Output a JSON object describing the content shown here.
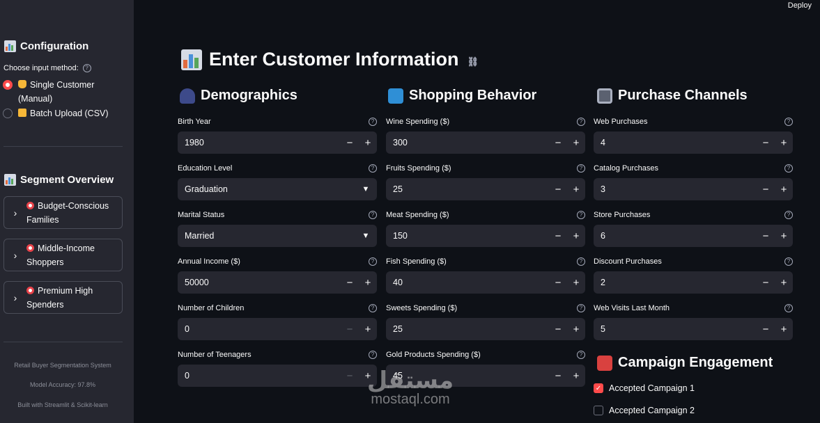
{
  "app": {
    "deploy_label": "Deploy"
  },
  "sidebar": {
    "config_title": "Configuration",
    "input_method_label": "Choose input method:",
    "options": [
      {
        "label_line1": "Single Customer",
        "label_line2": "(Manual)",
        "selected": true
      },
      {
        "label_line1": "Batch Upload (CSV)",
        "selected": false
      }
    ],
    "segment_title": "Segment Overview",
    "segments": [
      {
        "line1": "Budget-Conscious",
        "line2": "Families"
      },
      {
        "line1": "Middle-Income",
        "line2": "Shoppers"
      },
      {
        "line1": "Premium High",
        "line2": "Spenders"
      }
    ],
    "footer": {
      "system": "Retail Buyer Segmentation System",
      "accuracy": "Model Accuracy: 97.8%",
      "built": "Built with Streamlit & Scikit-learn"
    }
  },
  "main": {
    "title": "Enter Customer Information",
    "demographics": {
      "title": "Demographics",
      "birth_year": {
        "label": "Birth Year",
        "value": "1980"
      },
      "education": {
        "label": "Education Level",
        "value": "Graduation"
      },
      "marital": {
        "label": "Marital Status",
        "value": "Married"
      },
      "income": {
        "label": "Annual Income ($)",
        "value": "50000"
      },
      "children": {
        "label": "Number of Children",
        "value": "0"
      },
      "teenagers": {
        "label": "Number of Teenagers",
        "value": "0"
      }
    },
    "shopping": {
      "title": "Shopping Behavior",
      "wine": {
        "label": "Wine Spending ($)",
        "value": "300"
      },
      "fruits": {
        "label": "Fruits Spending ($)",
        "value": "25"
      },
      "meat": {
        "label": "Meat Spending ($)",
        "value": "150"
      },
      "fish": {
        "label": "Fish Spending ($)",
        "value": "40"
      },
      "sweets": {
        "label": "Sweets Spending ($)",
        "value": "25"
      },
      "gold": {
        "label": "Gold Products Spending ($)",
        "value": "45"
      }
    },
    "channels": {
      "title": "Purchase Channels",
      "web": {
        "label": "Web Purchases",
        "value": "4"
      },
      "catalog": {
        "label": "Catalog Purchases",
        "value": "3"
      },
      "store": {
        "label": "Store Purchases",
        "value": "6"
      },
      "discount": {
        "label": "Discount Purchases",
        "value": "2"
      },
      "visits": {
        "label": "Web Visits Last Month",
        "value": "5"
      }
    },
    "campaign": {
      "title": "Campaign Engagement",
      "c1": {
        "label": "Accepted Campaign 1",
        "checked": true
      },
      "c2": {
        "label": "Accepted Campaign 2",
        "checked": false
      }
    }
  },
  "watermark": {
    "arabic": "مستقل",
    "latin": "mostaql.com"
  },
  "colors": {
    "accent": "#ff4b4b",
    "background": "#0e1117",
    "sidebar": "#262730",
    "input": "#262730"
  }
}
